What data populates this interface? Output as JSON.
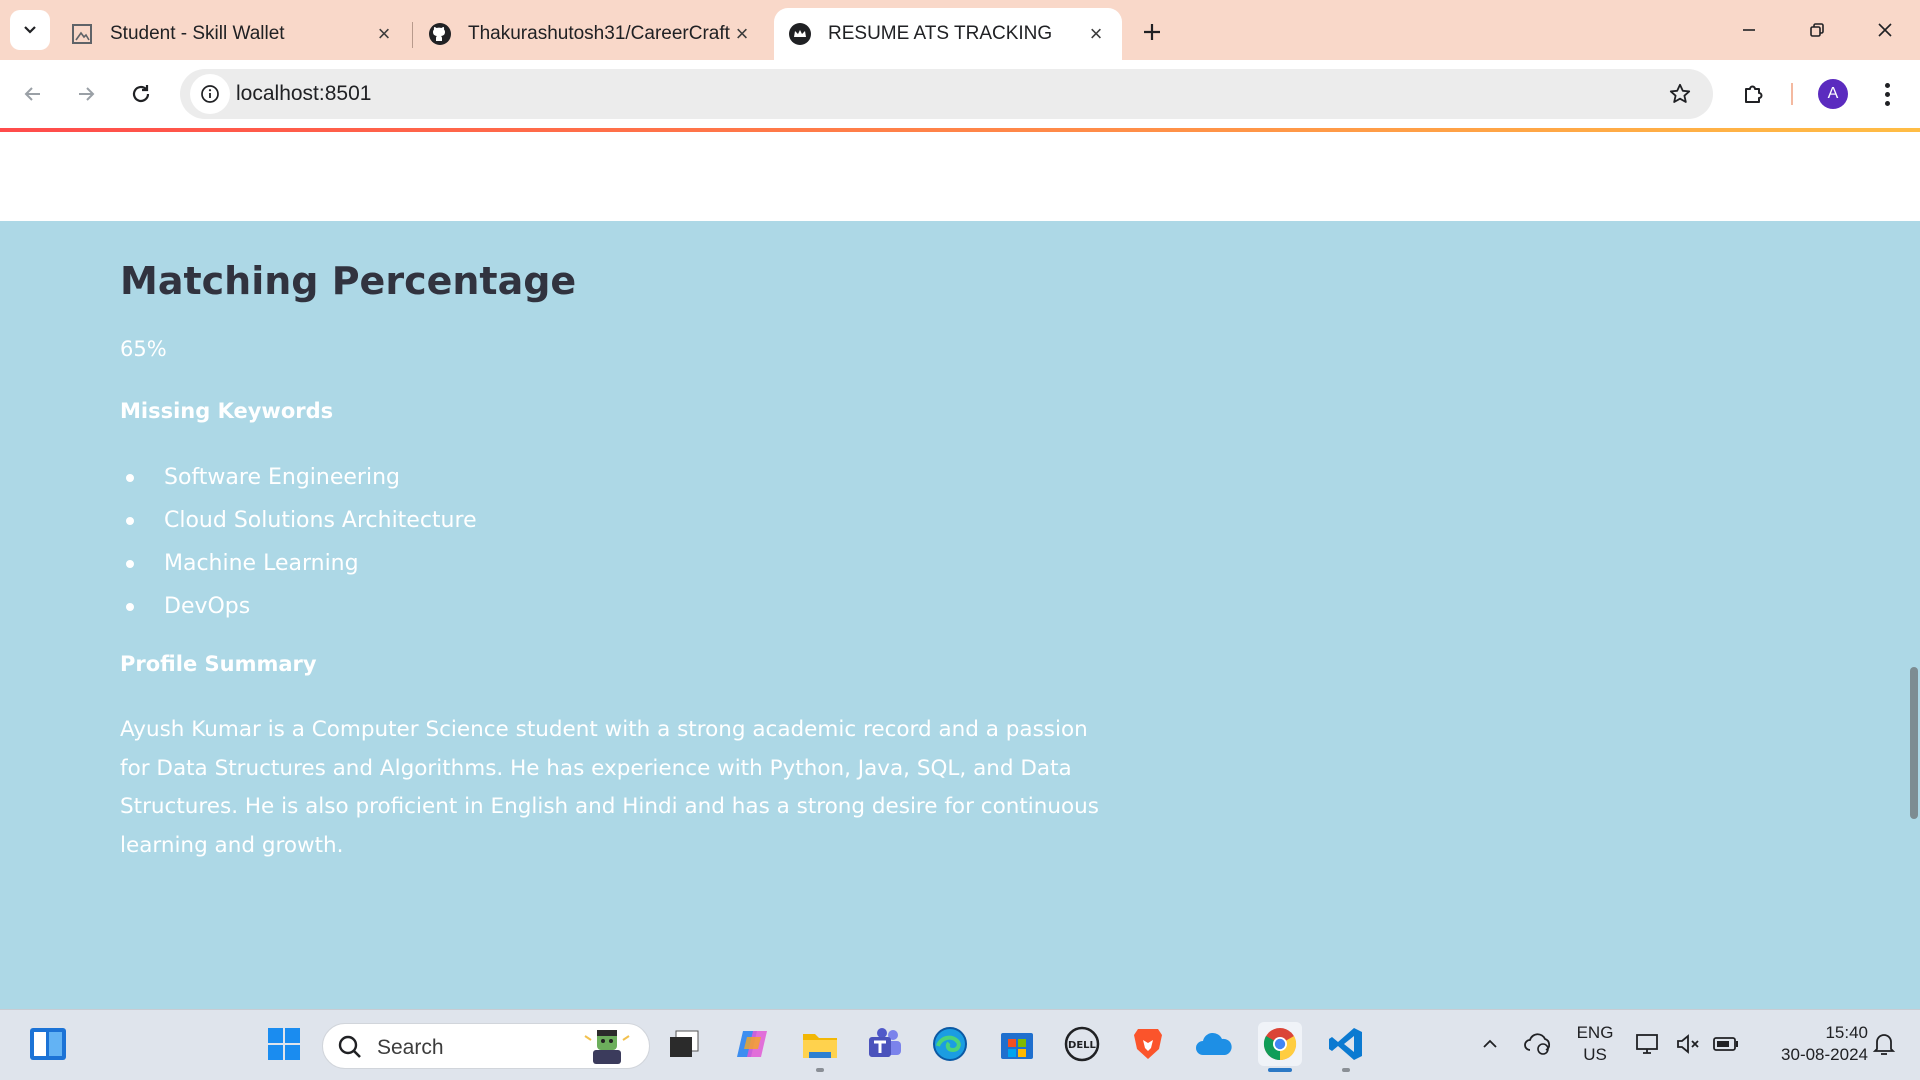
{
  "browser": {
    "tabs": [
      {
        "title": "Student - Skill Wallet",
        "favicon": "skill-wallet-icon",
        "active": false
      },
      {
        "title": "Thakurashutosh31/CareerCraft-",
        "favicon": "github-icon",
        "active": false
      },
      {
        "title": "RESUME ATS TRACKING",
        "favicon": "streamlit-crown-icon",
        "active": true
      }
    ],
    "url": "localhost:8501",
    "profile_initial": "A"
  },
  "page": {
    "heading": "Matching Percentage",
    "matching_percentage": "65%",
    "missing_keywords_label": "Missing Keywords",
    "missing_keywords": [
      "Software Engineering",
      "Cloud Solutions Architecture",
      "Machine Learning",
      "DevOps"
    ],
    "profile_summary_label": "Profile Summary",
    "profile_summary": "Ayush Kumar is a Computer Science student with a strong academic record and a passion for Data Structures and Algorithms. He has experience with Python, Java, SQL, and Data Structures. He is also proficient in English and Hindi and has a strong desire for continuous learning and growth.",
    "background_color": "#add8e6",
    "heading_color": "#31333f",
    "text_color": "#ffffff"
  },
  "taskbar": {
    "search_placeholder": "Search",
    "language_line1": "ENG",
    "language_line2": "US",
    "time": "15:40",
    "date": "30-08-2024"
  }
}
